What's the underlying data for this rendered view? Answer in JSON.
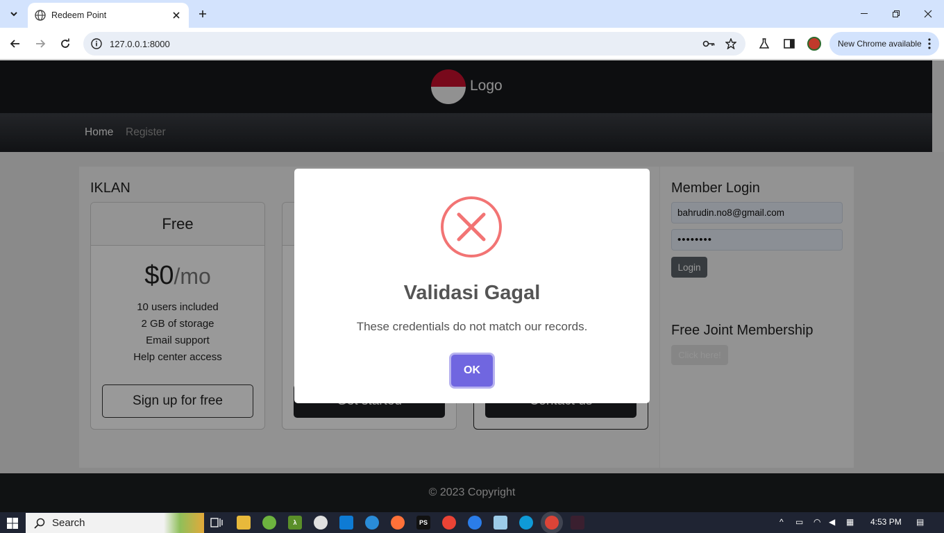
{
  "browser": {
    "tab_title": "Redeem Point",
    "url": "127.0.0.1:8000",
    "update_label": "New Chrome available"
  },
  "site": {
    "logo_text": "Logo",
    "nav": [
      {
        "label": "Home",
        "active": true
      },
      {
        "label": "Register",
        "active": false
      }
    ],
    "section_title": "IKLAN",
    "cards": [
      {
        "name": "Free",
        "price": "$0",
        "period": "/mo",
        "features": [
          "10 users included",
          "2 GB of storage",
          "Email support",
          "Help center access"
        ],
        "button": "Sign up for free",
        "style": "outline"
      },
      {
        "button": "Get started",
        "style": "dark"
      },
      {
        "button": "Contact us",
        "style": "dark"
      }
    ],
    "login": {
      "title": "Member Login",
      "email_value": "bahrudin.no8@gmail.com",
      "password_value": "••••••••",
      "login_button": "Login"
    },
    "membership": {
      "title": "Free Joint Membership",
      "button": "Click here!"
    },
    "footer": "© 2023 Copyright"
  },
  "modal": {
    "icon": "error-x-icon",
    "title": "Validasi Gagal",
    "text": "These credentials do not match our records.",
    "ok_label": "OK",
    "accent": "#7066e0",
    "icon_color": "#f27474"
  },
  "taskbar": {
    "search_label": "Search",
    "time": "4:53 PM"
  }
}
